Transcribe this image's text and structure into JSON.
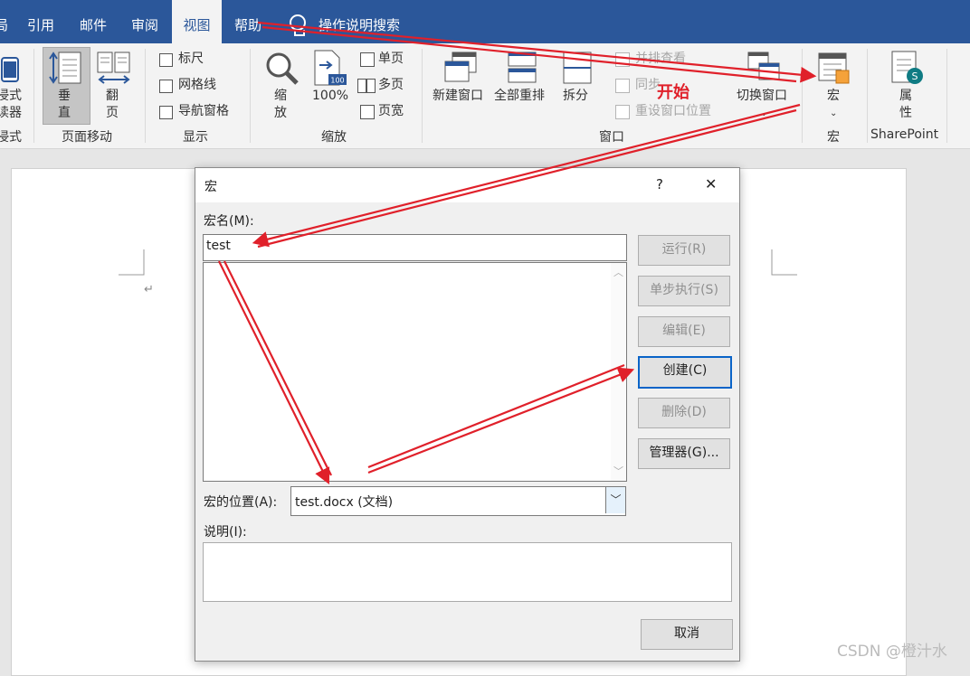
{
  "tabs": {
    "ref": "引用",
    "mail": "邮件",
    "review": "审阅",
    "view": "视图",
    "help": "帮助",
    "tellme": "操作说明搜索"
  },
  "ribbon": {
    "immersive": {
      "btn_line1": "浸式",
      "btn_line2": "读器",
      "group": "浸式"
    },
    "page_move": {
      "vertical_1": "垂",
      "vertical_2": "直",
      "flip_1": "翻",
      "flip_2": "页",
      "group": "页面移动"
    },
    "show": {
      "ruler": "标尺",
      "gridlines": "网格线",
      "navpane": "导航窗格",
      "group": "显示"
    },
    "zoom": {
      "zoom_1": "缩",
      "zoom_2": "放",
      "pct": "100%",
      "pct_badge": "100",
      "one_page": "单页",
      "multi_page": "多页",
      "page_width": "页宽",
      "group": "缩放"
    },
    "window": {
      "new_window": "新建窗口",
      "arrange_all": "全部重排",
      "split": "拆分",
      "side_by_side": "并排查看",
      "sync_scroll": "同步",
      "reset_pos": "重设窗口位置",
      "switch": "切换窗口",
      "group": "窗口"
    },
    "macros": {
      "label": "宏",
      "group": "宏"
    },
    "sharepoint": {
      "prop_1": "属",
      "prop_2": "性",
      "group": "SharePoint"
    }
  },
  "annotation": {
    "start": "开始"
  },
  "dialog": {
    "title": "宏",
    "help": "?",
    "close": "✕",
    "macro_name_label": "宏名(M):",
    "macro_name_value": "test",
    "buttons": {
      "run": "运行(R)",
      "step": "单步执行(S)",
      "edit": "编辑(E)",
      "create": "创建(C)",
      "delete": "删除(D)",
      "organizer": "管理器(G)...",
      "cancel": "取消"
    },
    "location_label": "宏的位置(A):",
    "location_value": "test.docx (文档)",
    "desc_label": "说明(I):"
  },
  "watermark": "CSDN @橙汁水",
  "colors": {
    "tabbar": "#2b579a",
    "arrow": "#e0202a",
    "focus": "#0a64c8"
  }
}
